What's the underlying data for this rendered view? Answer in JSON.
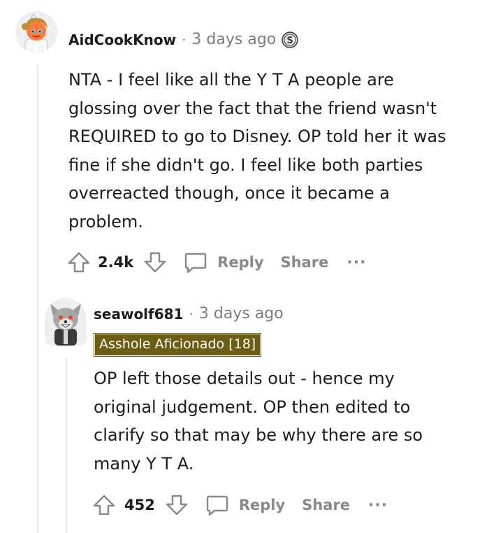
{
  "comments": [
    {
      "username": "AidCookKnow",
      "separator": "·",
      "timestamp": "3 days ago",
      "award_icon": "silver-dollar-award-icon",
      "body": "NTA - I feel like all the Y T A people are glossing over the fact that the friend wasn't REQUIRED to go to Disney. OP told her it was fine if she didn't go. I feel like both parties overreacted though, once it became a problem.",
      "score": "2.4k",
      "reply_label": "Reply",
      "share_label": "Share",
      "more_label": "···"
    },
    {
      "username": "seawolf681",
      "separator": "·",
      "timestamp": "3 days ago",
      "flair": "Asshole Aficionado [18]",
      "flair_color": "#6b5d14",
      "body": "OP left those details out - hence my original judgement. OP then edited to clarify so that may be why there are so many Y T A.",
      "score": "452",
      "reply_label": "Reply",
      "share_label": "Share",
      "more_label": "···"
    }
  ],
  "colors": {
    "meta_gray": "#7c7c7c",
    "action_gray": "#878a8c",
    "thread_line": "#e6e6e6"
  }
}
